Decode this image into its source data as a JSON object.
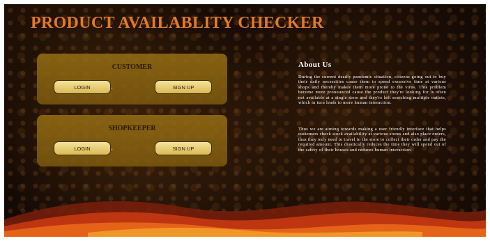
{
  "header": {
    "title": "PRODUCT AVAILABLITY CHECKER"
  },
  "customer": {
    "heading": "CUSTOMER",
    "login_label": "LOGIN",
    "separator": "-",
    "signup_label": "SIGN UP"
  },
  "shopkeeper": {
    "heading": "SHOPKEEPER",
    "login_label": "LOGIN",
    "separator": "-",
    "signup_label": "SIGN UP"
  },
  "about": {
    "title": "About Us",
    "paragraph1": "During the current deadly pandemic situation, citizens going out to buy their daily necessities cause them to spend excessive time at various shops and thereby makes them more prone to the virus. This problem become more pronounced cause the product they're looking for is often not available at a single store and they're left searching multiple outlets, which in turn leads to more human interaction.",
    "paragraph2": "Thus we are aiming towards making a user friendly interface that helps customers check stock availability at various stores and also place orders, thus they only need to travel to the store to collect their order and pay the required amount. This drastically reduces the time they will spend out of the safety of their houses and reduces human interaction."
  },
  "colors": {
    "title": "#e07a2a",
    "panel": "#8f6a14",
    "button": "#e8cd73",
    "background": "#140a05"
  }
}
